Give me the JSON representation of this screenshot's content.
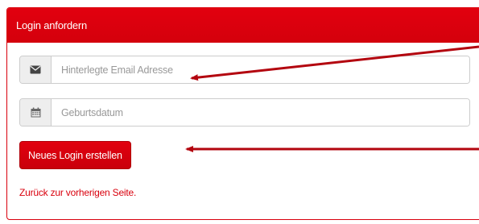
{
  "panel": {
    "title": "Login anfordern"
  },
  "email_field": {
    "icon": "envelope-icon",
    "placeholder": "Hinterlegte Email Adresse",
    "value": ""
  },
  "birth_field": {
    "icon": "calendar-icon",
    "placeholder": "Geburtsdatum",
    "value": ""
  },
  "submit_button": {
    "label": "Neues Login erstellen"
  },
  "back_link": {
    "label": "Zurück zur vorherigen Seite."
  },
  "colors": {
    "brand_red": "#e2000f",
    "annotation_arrow": "#b3050f"
  }
}
